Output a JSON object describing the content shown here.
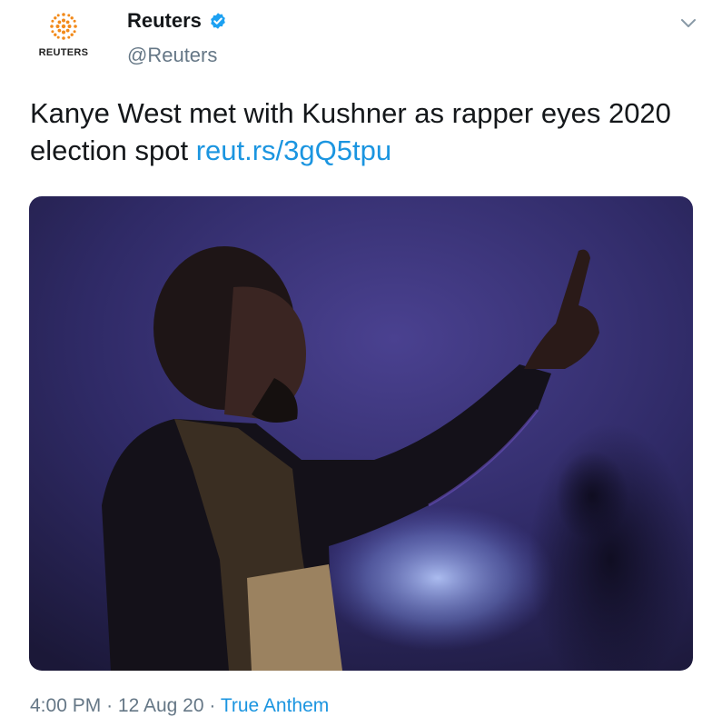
{
  "account": {
    "name": "Reuters",
    "handle": "@Reuters",
    "logo_text": "REUTERS",
    "verified": true
  },
  "tweet": {
    "text": "Kanye West met with Kushner as rapper eyes 2020 election spot",
    "link": "reut.rs/3gQ5tpu"
  },
  "meta": {
    "time": "4:00 PM",
    "separator": "·",
    "date": "12 Aug 20",
    "source": "True Anthem"
  },
  "colors": {
    "link": "#1b95e0",
    "secondary_text": "#657786",
    "brand_orange": "#f28a1a"
  },
  "icons": {
    "logo": "reuters-dot-logo",
    "verified": "verified-badge-icon",
    "menu": "chevron-down-icon"
  }
}
